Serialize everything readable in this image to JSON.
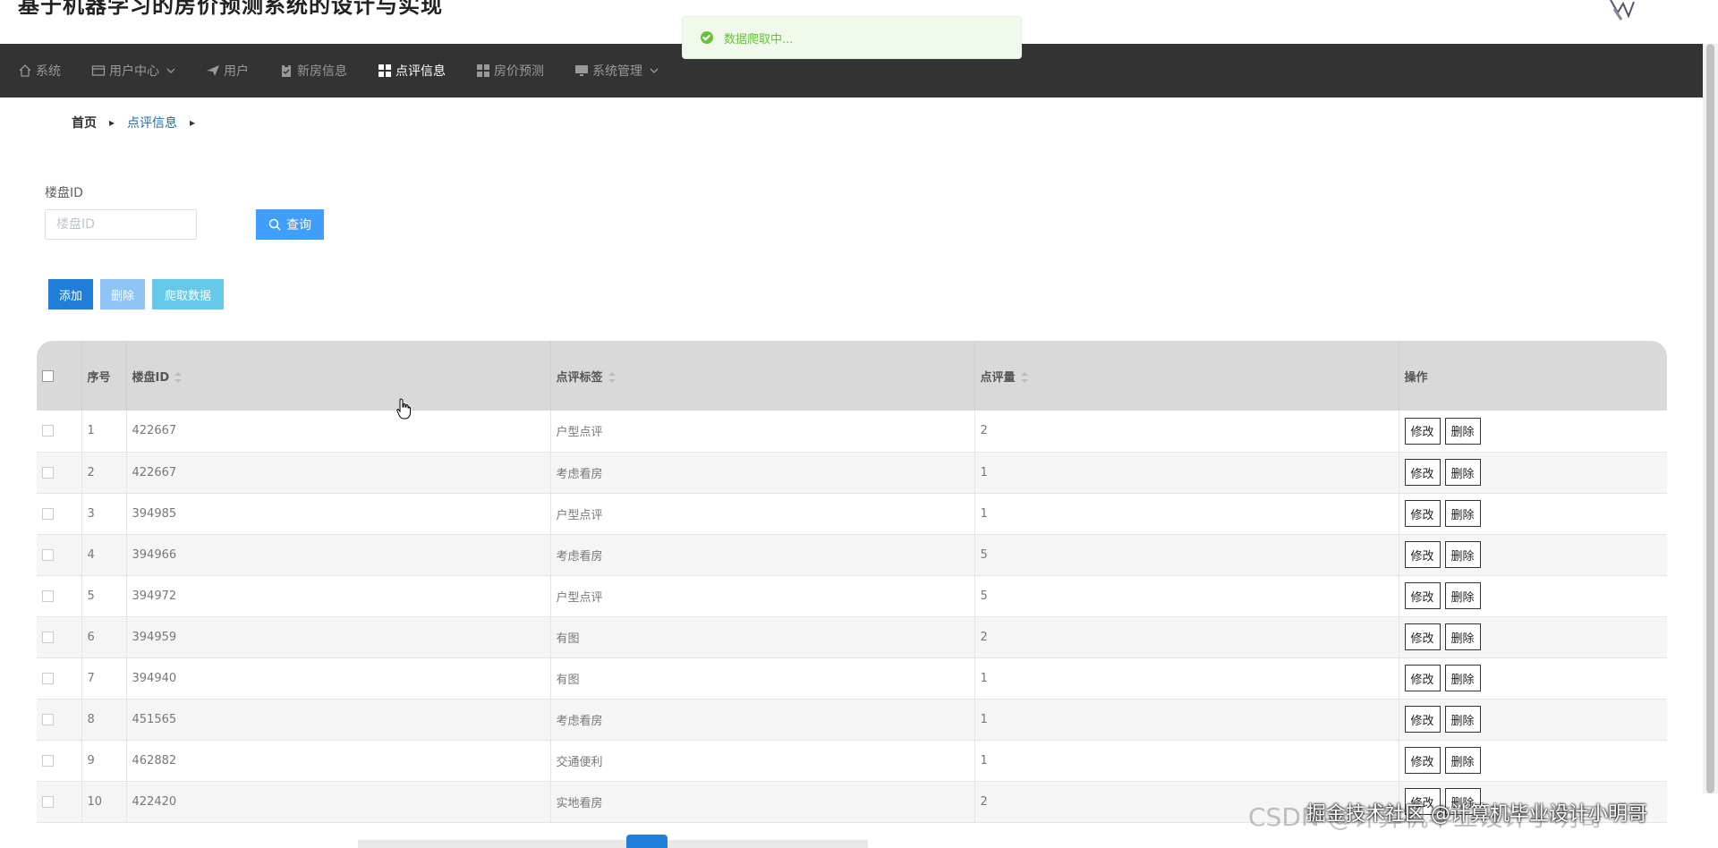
{
  "header": {
    "title": "基于机器学习的房价预测系统的设计与实现"
  },
  "toast": {
    "message": "数据爬取中..."
  },
  "nav": {
    "items": [
      {
        "label": "系统",
        "icon": "home-icon"
      },
      {
        "label": "用户中心",
        "icon": "card-icon",
        "dropdown": true
      },
      {
        "label": "用户",
        "icon": "paper-plane-icon"
      },
      {
        "label": "新房信息",
        "icon": "clipboard-icon"
      },
      {
        "label": "点评信息",
        "icon": "grid-icon",
        "active": true
      },
      {
        "label": "房价预测",
        "icon": "grid-icon"
      },
      {
        "label": "系统管理",
        "icon": "monitor-icon",
        "dropdown": true
      }
    ]
  },
  "breadcrumb": {
    "home": "首页",
    "current": "点评信息"
  },
  "search": {
    "label": "楼盘ID",
    "placeholder": "楼盘ID",
    "value": "",
    "button": "查询"
  },
  "actions": {
    "add": "添加",
    "delete": "删除",
    "crawl": "爬取数据"
  },
  "table": {
    "headers": {
      "index": "序号",
      "building_id": "楼盘ID",
      "tag": "点评标签",
      "count": "点评量",
      "ops": "操作"
    },
    "edit_label": "修改",
    "delete_label": "删除",
    "rows": [
      {
        "index": "1",
        "building_id": "422667",
        "tag": "户型点评",
        "count": "2"
      },
      {
        "index": "2",
        "building_id": "422667",
        "tag": "考虑看房",
        "count": "1"
      },
      {
        "index": "3",
        "building_id": "394985",
        "tag": "户型点评",
        "count": "1"
      },
      {
        "index": "4",
        "building_id": "394966",
        "tag": "考虑看房",
        "count": "5"
      },
      {
        "index": "5",
        "building_id": "394972",
        "tag": "户型点评",
        "count": "5"
      },
      {
        "index": "6",
        "building_id": "394959",
        "tag": "有图",
        "count": "2"
      },
      {
        "index": "7",
        "building_id": "394940",
        "tag": "有图",
        "count": "1"
      },
      {
        "index": "8",
        "building_id": "451565",
        "tag": "考虑看房",
        "count": "1"
      },
      {
        "index": "9",
        "building_id": "462882",
        "tag": "交通便利",
        "count": "1"
      },
      {
        "index": "10",
        "building_id": "422420",
        "tag": "实地看房",
        "count": "2"
      }
    ]
  },
  "watermark": {
    "back": "CSDN @计算机毕业设计小明哥",
    "front": "掘金技术社区 @计算机毕业设计小明哥"
  }
}
